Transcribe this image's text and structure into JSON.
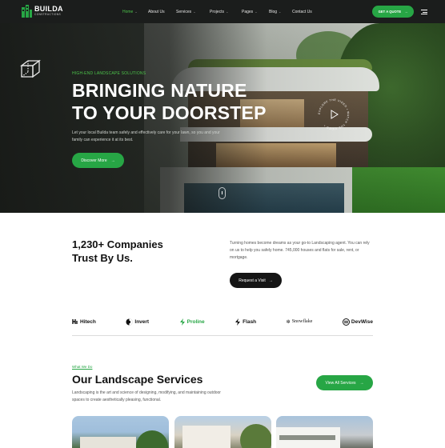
{
  "logo": {
    "name": "BUILDA",
    "sub": "CONSTRUCTIONS"
  },
  "nav": {
    "items": [
      {
        "label": "Home",
        "caret": true,
        "active": true
      },
      {
        "label": "About Us",
        "caret": false
      },
      {
        "label": "Services",
        "caret": true
      },
      {
        "label": "Projects",
        "caret": true
      },
      {
        "label": "Pages",
        "caret": true
      },
      {
        "label": "Blog",
        "caret": true
      },
      {
        "label": "Contact Us",
        "caret": false
      }
    ],
    "cta": "GET A QUOTE"
  },
  "hero": {
    "kicker": "HIGH-END LANDSCAPE SOLUTIONS",
    "title_line1": "BRINGING NATURE",
    "title_line2": "TO YOUR DOORSTEP",
    "description": "Let your local Builda team safely and effectively care for your lawn, so you and your family can experience it at its best.",
    "button": "Discover More",
    "circle_text": "EXPLORE THE VIDEO • WATCH THE VIDEO •"
  },
  "trust": {
    "title_line1": "1,230+ Companies",
    "title_line2": "Trust By Us.",
    "description": "Turning homes become dreams as your go-to Landscaping agent. You can rely on us to help you safely home. 745,000 houses and flats for sale, rent, or mortgage.",
    "button": "Request a Visit"
  },
  "brands": [
    {
      "label": "Hitech",
      "icon": "hitech-icon"
    },
    {
      "label": "Invert",
      "icon": "invert-icon"
    },
    {
      "label": "Proline",
      "icon": "proline-icon"
    },
    {
      "label": "Flash",
      "icon": "flash-icon"
    },
    {
      "label": "Snowflake",
      "icon": "snowflake-icon"
    },
    {
      "label": "DevWise",
      "icon": "devwise-icon"
    }
  ],
  "services": {
    "kicker": "What We Do",
    "title": "Our Landscape Services",
    "description": "Landscaping is the art and science of designing, modifying, and maintaining outdoor spaces to create aesthetically pleasing, functional.",
    "button": "View All Services"
  },
  "colors": {
    "accent": "#27a645",
    "nav_bg": "#1b1d1c",
    "dark": "#151515"
  }
}
